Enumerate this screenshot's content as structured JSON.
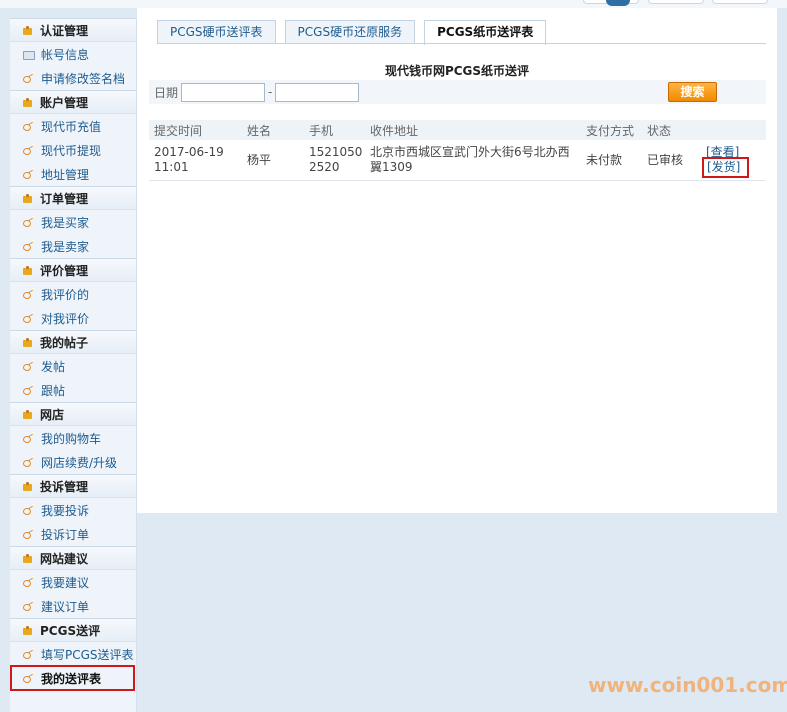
{
  "sidebar": {
    "groups": [
      {
        "title": "认证管理",
        "items": [
          "帐号信息",
          "申请修改签名档"
        ]
      },
      {
        "title": "账户管理",
        "items": [
          "现代币充值",
          "现代币提现",
          "地址管理"
        ]
      },
      {
        "title": "订单管理",
        "items": [
          "我是买家",
          "我是卖家"
        ]
      },
      {
        "title": "评价管理",
        "items": [
          "我评价的",
          "对我评价"
        ]
      },
      {
        "title": "我的帖子",
        "items": [
          "发帖",
          "跟帖"
        ]
      },
      {
        "title": "网店",
        "items": [
          "我的购物车",
          "网店续费/升级"
        ]
      },
      {
        "title": "投诉管理",
        "items": [
          "我要投诉",
          "投诉订单"
        ]
      },
      {
        "title": "网站建议",
        "items": [
          "我要建议",
          "建议订单"
        ]
      },
      {
        "title": "PCGS送评",
        "items": [
          "填写PCGS送评表",
          "我的送评表"
        ]
      }
    ]
  },
  "tabs": [
    "PCGS硬币送评表",
    "PCGS硬币还原服务",
    "PCGS纸币送评表"
  ],
  "active_tab": 2,
  "heading": "现代钱币网PCGS纸币送评",
  "search": {
    "date_label": "日期",
    "date_from": "",
    "date_to": "",
    "separator": "-",
    "button_label": "搜索"
  },
  "table": {
    "headers": [
      "提交时间",
      "姓名",
      "手机",
      "收件地址",
      "支付方式",
      "状态"
    ],
    "rows": [
      {
        "time": "2017-06-19 11:01",
        "name": "杨平",
        "phone": "15210502520",
        "address": "北京市西城区宣武门外大街6号北办西翼1309",
        "payment": "未付款",
        "status": "已审核",
        "action_view": "[查看]",
        "action_ship": "[发货]"
      }
    ]
  },
  "watermark": "www.coin001.com",
  "colors": {
    "link": "#1f5b8e",
    "highlight_box": "#d01818",
    "search_button": "#f08b00",
    "watermark": "#f1b37c"
  }
}
